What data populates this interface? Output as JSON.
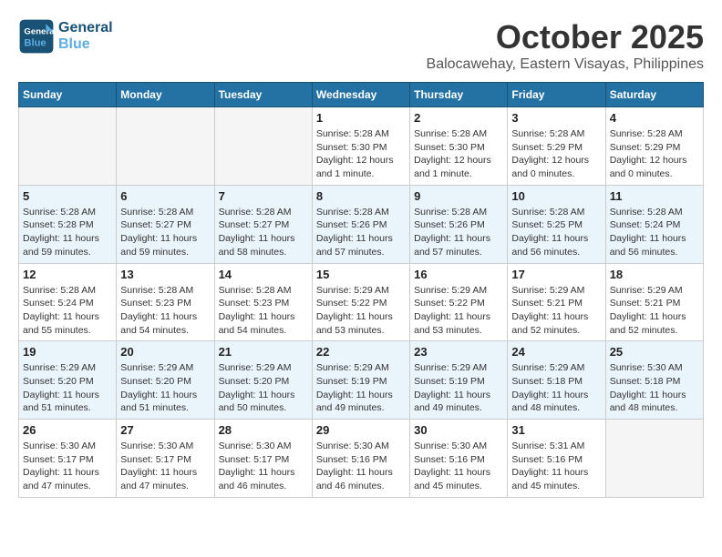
{
  "header": {
    "logo_line1": "General",
    "logo_line2": "Blue",
    "month": "October 2025",
    "location": "Balocawehay, Eastern Visayas, Philippines"
  },
  "weekdays": [
    "Sunday",
    "Monday",
    "Tuesday",
    "Wednesday",
    "Thursday",
    "Friday",
    "Saturday"
  ],
  "weeks": [
    [
      {
        "day": "",
        "info": ""
      },
      {
        "day": "",
        "info": ""
      },
      {
        "day": "",
        "info": ""
      },
      {
        "day": "1",
        "info": "Sunrise: 5:28 AM\nSunset: 5:30 PM\nDaylight: 12 hours\nand 1 minute."
      },
      {
        "day": "2",
        "info": "Sunrise: 5:28 AM\nSunset: 5:30 PM\nDaylight: 12 hours\nand 1 minute."
      },
      {
        "day": "3",
        "info": "Sunrise: 5:28 AM\nSunset: 5:29 PM\nDaylight: 12 hours\nand 0 minutes."
      },
      {
        "day": "4",
        "info": "Sunrise: 5:28 AM\nSunset: 5:29 PM\nDaylight: 12 hours\nand 0 minutes."
      }
    ],
    [
      {
        "day": "5",
        "info": "Sunrise: 5:28 AM\nSunset: 5:28 PM\nDaylight: 11 hours\nand 59 minutes."
      },
      {
        "day": "6",
        "info": "Sunrise: 5:28 AM\nSunset: 5:27 PM\nDaylight: 11 hours\nand 59 minutes."
      },
      {
        "day": "7",
        "info": "Sunrise: 5:28 AM\nSunset: 5:27 PM\nDaylight: 11 hours\nand 58 minutes."
      },
      {
        "day": "8",
        "info": "Sunrise: 5:28 AM\nSunset: 5:26 PM\nDaylight: 11 hours\nand 57 minutes."
      },
      {
        "day": "9",
        "info": "Sunrise: 5:28 AM\nSunset: 5:26 PM\nDaylight: 11 hours\nand 57 minutes."
      },
      {
        "day": "10",
        "info": "Sunrise: 5:28 AM\nSunset: 5:25 PM\nDaylight: 11 hours\nand 56 minutes."
      },
      {
        "day": "11",
        "info": "Sunrise: 5:28 AM\nSunset: 5:24 PM\nDaylight: 11 hours\nand 56 minutes."
      }
    ],
    [
      {
        "day": "12",
        "info": "Sunrise: 5:28 AM\nSunset: 5:24 PM\nDaylight: 11 hours\nand 55 minutes."
      },
      {
        "day": "13",
        "info": "Sunrise: 5:28 AM\nSunset: 5:23 PM\nDaylight: 11 hours\nand 54 minutes."
      },
      {
        "day": "14",
        "info": "Sunrise: 5:28 AM\nSunset: 5:23 PM\nDaylight: 11 hours\nand 54 minutes."
      },
      {
        "day": "15",
        "info": "Sunrise: 5:29 AM\nSunset: 5:22 PM\nDaylight: 11 hours\nand 53 minutes."
      },
      {
        "day": "16",
        "info": "Sunrise: 5:29 AM\nSunset: 5:22 PM\nDaylight: 11 hours\nand 53 minutes."
      },
      {
        "day": "17",
        "info": "Sunrise: 5:29 AM\nSunset: 5:21 PM\nDaylight: 11 hours\nand 52 minutes."
      },
      {
        "day": "18",
        "info": "Sunrise: 5:29 AM\nSunset: 5:21 PM\nDaylight: 11 hours\nand 52 minutes."
      }
    ],
    [
      {
        "day": "19",
        "info": "Sunrise: 5:29 AM\nSunset: 5:20 PM\nDaylight: 11 hours\nand 51 minutes."
      },
      {
        "day": "20",
        "info": "Sunrise: 5:29 AM\nSunset: 5:20 PM\nDaylight: 11 hours\nand 51 minutes."
      },
      {
        "day": "21",
        "info": "Sunrise: 5:29 AM\nSunset: 5:20 PM\nDaylight: 11 hours\nand 50 minutes."
      },
      {
        "day": "22",
        "info": "Sunrise: 5:29 AM\nSunset: 5:19 PM\nDaylight: 11 hours\nand 49 minutes."
      },
      {
        "day": "23",
        "info": "Sunrise: 5:29 AM\nSunset: 5:19 PM\nDaylight: 11 hours\nand 49 minutes."
      },
      {
        "day": "24",
        "info": "Sunrise: 5:29 AM\nSunset: 5:18 PM\nDaylight: 11 hours\nand 48 minutes."
      },
      {
        "day": "25",
        "info": "Sunrise: 5:30 AM\nSunset: 5:18 PM\nDaylight: 11 hours\nand 48 minutes."
      }
    ],
    [
      {
        "day": "26",
        "info": "Sunrise: 5:30 AM\nSunset: 5:17 PM\nDaylight: 11 hours\nand 47 minutes."
      },
      {
        "day": "27",
        "info": "Sunrise: 5:30 AM\nSunset: 5:17 PM\nDaylight: 11 hours\nand 47 minutes."
      },
      {
        "day": "28",
        "info": "Sunrise: 5:30 AM\nSunset: 5:17 PM\nDaylight: 11 hours\nand 46 minutes."
      },
      {
        "day": "29",
        "info": "Sunrise: 5:30 AM\nSunset: 5:16 PM\nDaylight: 11 hours\nand 46 minutes."
      },
      {
        "day": "30",
        "info": "Sunrise: 5:30 AM\nSunset: 5:16 PM\nDaylight: 11 hours\nand 45 minutes."
      },
      {
        "day": "31",
        "info": "Sunrise: 5:31 AM\nSunset: 5:16 PM\nDaylight: 11 hours\nand 45 minutes."
      },
      {
        "day": "",
        "info": ""
      }
    ]
  ]
}
